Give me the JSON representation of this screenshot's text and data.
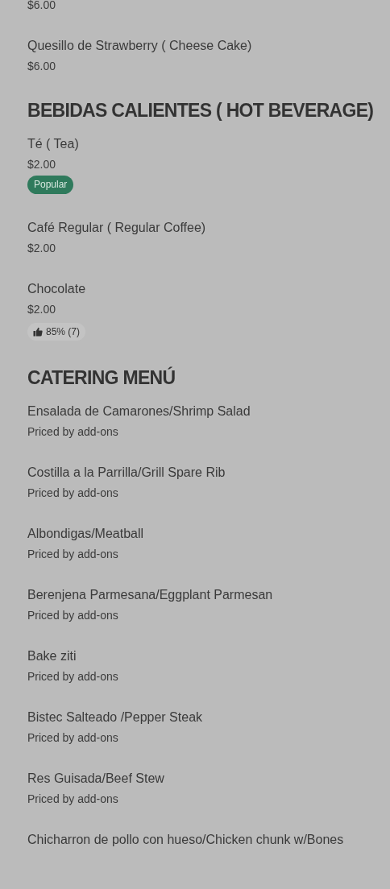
{
  "sections": [
    {
      "items": [
        {
          "price": "$6.00"
        },
        {
          "name": "Quesillo de Strawberry ( Cheese Cake)",
          "price": "$6.00"
        }
      ]
    },
    {
      "heading": "BEBIDAS CALIENTES ( HOT BEVERAGE)",
      "items": [
        {
          "name": "Té ( Tea)",
          "price": "$2.00",
          "tag": {
            "kind": "popular",
            "label": "Popular"
          }
        },
        {
          "name": "Café Regular ( Regular Coffee)",
          "price": "$2.00"
        },
        {
          "name": "Chocolate",
          "price": "$2.00",
          "tag": {
            "kind": "rating",
            "label": "85% (7)"
          }
        }
      ]
    },
    {
      "heading": "CATERING MENÚ",
      "items": [
        {
          "name": "Ensalada de Camarones/Shrimp Salad",
          "price": "Priced by add-ons"
        },
        {
          "name": "Costilla a la Parrilla/Grill Spare Rib",
          "price": "Priced by add-ons"
        },
        {
          "name": "Albondigas/Meatball",
          "price": "Priced by add-ons"
        },
        {
          "name": "Berenjena Parmesana/Eggplant Parmesan",
          "price": "Priced by add-ons"
        },
        {
          "name": "Bake ziti",
          "price": "Priced by add-ons"
        },
        {
          "name": "Bistec Salteado /Pepper Steak",
          "price": "Priced by add-ons"
        },
        {
          "name": "Res Guisada/Beef Stew",
          "price": "Priced by add-ons"
        },
        {
          "name": "Chicharron de pollo con hueso/Chicken chunk w/Bones"
        }
      ]
    }
  ]
}
